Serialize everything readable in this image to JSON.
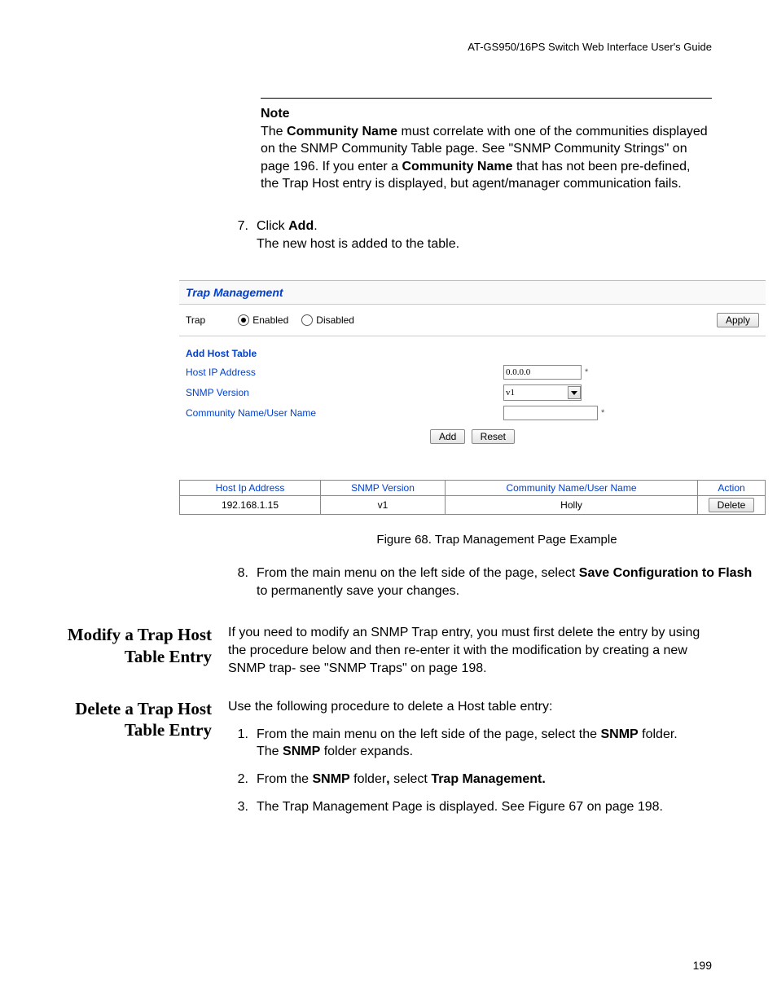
{
  "header": {
    "running": "AT-GS950/16PS Switch Web Interface User's Guide"
  },
  "note": {
    "heading": "Note",
    "text_pre": "The ",
    "text_b1": "Community Name",
    "text_mid1": " must correlate with one of the communities displayed on the SNMP Community Table page. See \"SNMP Community Strings\" on page 196. If you enter a ",
    "text_b2": "Community Name",
    "text_mid2": " that has not been pre-defined, the Trap Host entry is displayed, but agent/manager communication fails."
  },
  "step7": {
    "num": "7.",
    "line1_pre": "Click ",
    "line1_b": "Add",
    "line1_post": ".",
    "line2": "The new host is added to the table."
  },
  "gui": {
    "title": "Trap Management",
    "trap_label": "Trap",
    "enabled": "Enabled",
    "disabled": "Disabled",
    "apply": "Apply",
    "add_host_heading": "Add Host Table",
    "host_ip_label": "Host IP Address",
    "host_ip_value": "0.0.0.0",
    "host_ip_req": "*",
    "snmp_version_label": "SNMP Version",
    "snmp_version_value": "v1",
    "community_label": "Community Name/User Name",
    "community_value": "",
    "community_req": "*",
    "add_btn": "Add",
    "reset_btn": "Reset"
  },
  "host_table": {
    "headers": [
      "Host Ip Address",
      "SNMP Version",
      "Community Name/User Name",
      "Action"
    ],
    "rows": [
      {
        "ip": "192.168.1.15",
        "ver": "v1",
        "comm": "Holly",
        "action": "Delete"
      }
    ]
  },
  "figure_caption": "Figure 68. Trap Management Page Example",
  "step8": {
    "num": "8.",
    "pre": "From the main menu on the left side of the page, select ",
    "b1": "Save Configuration to Flash",
    "post": " to permanently save your changes."
  },
  "modify": {
    "heading": "Modify a Trap Host Table Entry",
    "text": "If you need to modify an SNMP Trap entry, you must first delete the entry by using the procedure below and then re-enter it with the modification by creating a new SNMP trap- see \"SNMP Traps\" on page 198."
  },
  "delete": {
    "heading": "Delete a Trap Host Table Entry",
    "intro": "Use the following procedure to delete a Host table entry:",
    "s1": {
      "num": "1.",
      "pre": "From the main menu on the left side of the page, select the ",
      "b1": "SNMP",
      "post": " folder.",
      "line2_pre": "The ",
      "line2_b": "SNMP",
      "line2_post": " folder expands."
    },
    "s2": {
      "num": "2.",
      "pre": "From the ",
      "b1": "SNMP",
      "mid": " folder",
      "b_comma": ",",
      "mid2": " select ",
      "b2": "Trap Management."
    },
    "s3": {
      "num": "3.",
      "text": "The Trap Management Page is displayed. See Figure 67 on page 198."
    }
  },
  "page_number": "199"
}
